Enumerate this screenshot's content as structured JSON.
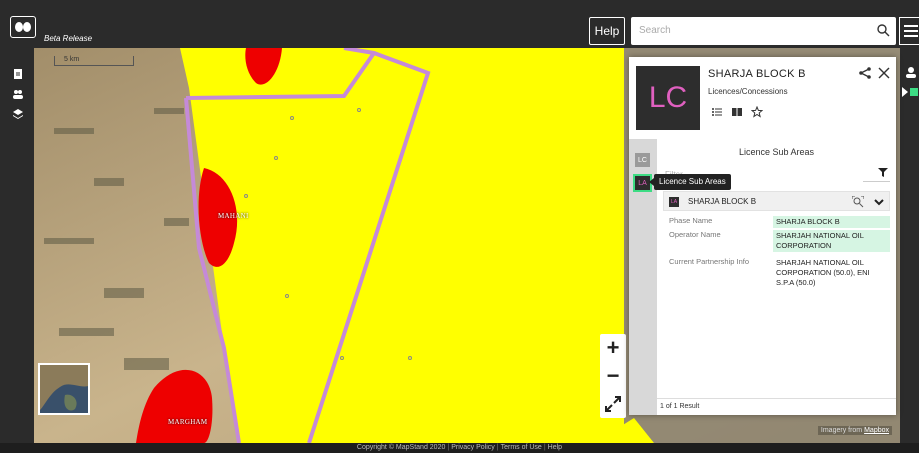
{
  "header": {
    "beta_label": "Beta Release",
    "help_label": "Help",
    "search_placeholder": "Search"
  },
  "map": {
    "scale_label": "5 km",
    "place_labels": [
      "MAHANI",
      "MARGHAM"
    ],
    "zoom_in_label": "+",
    "zoom_out_label": "−",
    "attribution": "Imagery from ",
    "attribution_link": "Mapbox"
  },
  "panel": {
    "badge": "LC",
    "title": "SHARJA BLOCK B",
    "subtitle": "Licences/Concessions",
    "tabs": [
      "LC",
      "LA"
    ],
    "tooltip": "Licence Sub Areas",
    "section_title": "Licence Sub Areas",
    "filter_placeholder": "Filter...",
    "card": {
      "badge": "LA",
      "title": "SHARJA BLOCK B",
      "rows": [
        {
          "key": "Phase Name",
          "value": "SHARJA BLOCK B"
        },
        {
          "key": "Operator Name",
          "value": "SHARJAH NATIONAL OIL CORPORATION"
        },
        {
          "key": "Current Partnership Info",
          "value": "SHARJAH NATIONAL OIL CORPORATION (50.0), ENI S.P.A (50.0)"
        }
      ]
    },
    "results": "1 of 1 Result"
  },
  "footer": {
    "copyright": "Copyright © MapStand 2020",
    "links": [
      "Privacy Policy",
      "Terms of Use",
      "Help"
    ]
  },
  "colors": {
    "licence_fill": "#ffff00",
    "licence_border": "#c58ad8",
    "other_fill": "#ee0000",
    "badge_text": "#e060c0",
    "highlight": "#d6f5e3"
  }
}
